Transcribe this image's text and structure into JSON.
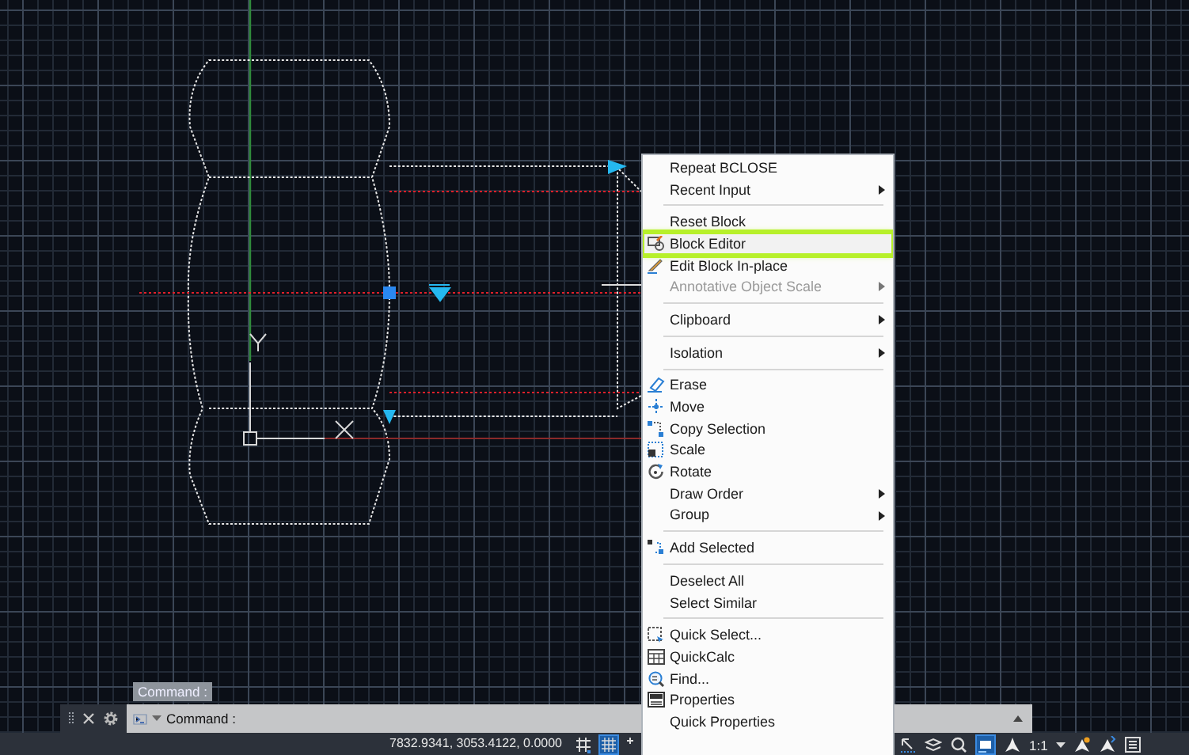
{
  "context_menu": {
    "items": [
      {
        "kind": "command",
        "label": "Repeat BCLOSE",
        "submenu": false,
        "disabled": false,
        "highlighted": false
      },
      {
        "kind": "command",
        "label": "Recent Input",
        "submenu": true,
        "disabled": false,
        "highlighted": false
      },
      {
        "kind": "separator"
      },
      {
        "kind": "command",
        "label": "Reset Block",
        "submenu": false,
        "disabled": false,
        "highlighted": false
      },
      {
        "kind": "command",
        "label": "Block Editor",
        "submenu": false,
        "disabled": false,
        "highlighted": true
      },
      {
        "kind": "command",
        "label": "Edit Block In-place",
        "submenu": false,
        "disabled": false,
        "highlighted": false
      },
      {
        "kind": "command",
        "label": "Annotative Object Scale",
        "submenu": true,
        "disabled": true,
        "highlighted": false
      },
      {
        "kind": "separator"
      },
      {
        "kind": "command",
        "label": "Clipboard",
        "submenu": true,
        "disabled": false,
        "highlighted": false
      },
      {
        "kind": "separator"
      },
      {
        "kind": "command",
        "label": "Isolation",
        "submenu": true,
        "disabled": false,
        "highlighted": false
      },
      {
        "kind": "separator"
      },
      {
        "kind": "command",
        "label": "Erase",
        "submenu": false,
        "disabled": false,
        "highlighted": false
      },
      {
        "kind": "command",
        "label": "Move",
        "submenu": false,
        "disabled": false,
        "highlighted": false
      },
      {
        "kind": "command",
        "label": "Copy Selection",
        "submenu": false,
        "disabled": false,
        "highlighted": false
      },
      {
        "kind": "command",
        "label": "Scale",
        "submenu": false,
        "disabled": false,
        "highlighted": false
      },
      {
        "kind": "command",
        "label": "Rotate",
        "submenu": false,
        "disabled": false,
        "highlighted": false
      },
      {
        "kind": "command",
        "label": "Draw Order",
        "submenu": true,
        "disabled": false,
        "highlighted": false
      },
      {
        "kind": "command",
        "label": "Group",
        "submenu": true,
        "disabled": false,
        "highlighted": false
      },
      {
        "kind": "separator"
      },
      {
        "kind": "command",
        "label": "Add Selected",
        "submenu": false,
        "disabled": false,
        "highlighted": false
      },
      {
        "kind": "separator"
      },
      {
        "kind": "command",
        "label": "Deselect All",
        "submenu": false,
        "disabled": false,
        "highlighted": false
      },
      {
        "kind": "command",
        "label": "Select Similar",
        "submenu": false,
        "disabled": false,
        "highlighted": false
      },
      {
        "kind": "separator"
      },
      {
        "kind": "command",
        "label": "Quick Select...",
        "submenu": false,
        "disabled": false,
        "highlighted": false
      },
      {
        "kind": "command",
        "label": "QuickCalc",
        "submenu": false,
        "disabled": false,
        "highlighted": false
      },
      {
        "kind": "command",
        "label": "Find...",
        "submenu": false,
        "disabled": false,
        "highlighted": false
      },
      {
        "kind": "command",
        "label": "Properties",
        "submenu": false,
        "disabled": false,
        "highlighted": false
      },
      {
        "kind": "command",
        "label": "Quick Properties",
        "submenu": false,
        "disabled": false,
        "highlighted": false
      }
    ]
  },
  "command_line": {
    "history": "Command :",
    "prompt": "Command :"
  },
  "status_bar": {
    "coordinates": "7832.9341, 3053.4122, 0.0000",
    "annotation_scale": "1:1"
  }
}
